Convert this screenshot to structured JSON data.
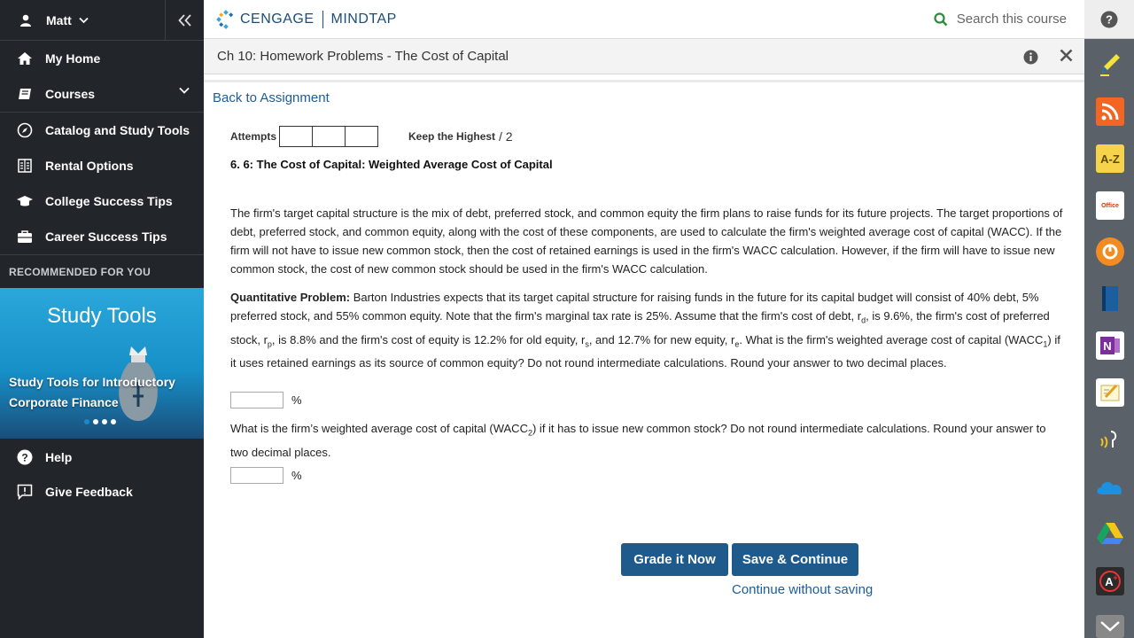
{
  "sidebar": {
    "user_name": "Matt",
    "nav": [
      {
        "label": "My Home",
        "icon": "home-icon"
      },
      {
        "label": "Courses",
        "icon": "courses-icon"
      },
      {
        "label": "Catalog and Study Tools",
        "icon": "compass-icon"
      },
      {
        "label": "Rental Options",
        "icon": "book-list-icon"
      },
      {
        "label": "College Success Tips",
        "icon": "graduation-cap-icon"
      },
      {
        "label": "Career Success Tips",
        "icon": "briefcase-icon"
      }
    ],
    "recommended_heading": "RECOMMENDED FOR YOU",
    "promo": {
      "title": "Study Tools",
      "caption": "Study Tools for Introductory Corporate Finance"
    },
    "lower_nav": [
      {
        "label": "Help",
        "icon": "help-icon"
      },
      {
        "label": "Give Feedback",
        "icon": "feedback-icon"
      }
    ]
  },
  "header": {
    "brand_left": "CENGAGE",
    "brand_right": "MINDTAP",
    "search_placeholder": "Search this course"
  },
  "titlebar": {
    "title": "Ch 10: Homework Problems - The Cost of Capital"
  },
  "content": {
    "back_link": "Back to Assignment",
    "attempts_label": "Attempts",
    "keep_label": "Keep the Highest",
    "keep_of": "/ 2",
    "question_heading": "6.  6: The Cost of Capital: Weighted Average Cost of Capital",
    "intro": "The firm's target capital structure is the mix of debt, preferred stock, and common equity the firm plans to raise funds for its future projects. The target proportions of debt, preferred stock, and common equity, along with the cost of these components, are used to calculate the firm's weighted average cost of capital (WACC). If the firm will not have to issue new common stock, then the cost of retained earnings is used in the firm's WACC calculation. However, if the firm will have to issue new common stock, the cost of new common stock should be used in the firm's WACC calculation.",
    "qp_label": "Quantitative Problem:",
    "qp_text_1": " Barton Industries expects that its target capital structure for raising funds in the future for its capital budget will consist of 40% debt, 5% preferred stock, and 55% common equity. Note that the firm's marginal tax rate is 25%. Assume that the firm's cost of debt, r",
    "sub_d": "d",
    "qp_text_2": ", is 9.6%, the firm's cost of preferred stock, r",
    "sub_p": "p",
    "qp_text_3": ", is 8.8% and the firm's cost of equity is 12.2% for old equity, r",
    "sub_s": "s",
    "qp_text_4": ", and 12.7% for new equity, r",
    "sub_e": "e",
    "qp_text_5": ". What is the firm's weighted average cost of capital (WACC",
    "sub_1": "1",
    "qp_text_6": ") if it uses retained earnings as its source of common equity? Do not round intermediate calculations. Round your answer to two decimal places.",
    "q2_text_1": "What is the firm’s weighted average cost of capital (WACC",
    "sub_2": "2",
    "q2_text_2": ") if it has to issue new common stock? Do not round intermediate calculations. Round your answer to two decimal places.",
    "percent": "%",
    "answer1_value": "",
    "answer2_value": "",
    "grade_button": "Grade it Now",
    "save_button": "Save & Continue",
    "continue_link": "Continue without saving"
  },
  "rail": {
    "icons": [
      "pencil-highlighter-icon",
      "rss-icon",
      "a-z-dictionary-icon",
      "office-icon",
      "kaltura-icon",
      "ebook-icon",
      "onenote-icon",
      "notes-icon",
      "readspeaker-icon",
      "onedrive-icon",
      "google-drive-icon",
      "aplus-icon",
      "more-chevron-icon"
    ],
    "az_label": "A-Z",
    "office_label": "Office"
  },
  "colors": {
    "accent": "#1f5a8c",
    "link": "#1a5e9a",
    "sidebar_bg": "#22262b",
    "rail_bg": "#5b6169"
  }
}
